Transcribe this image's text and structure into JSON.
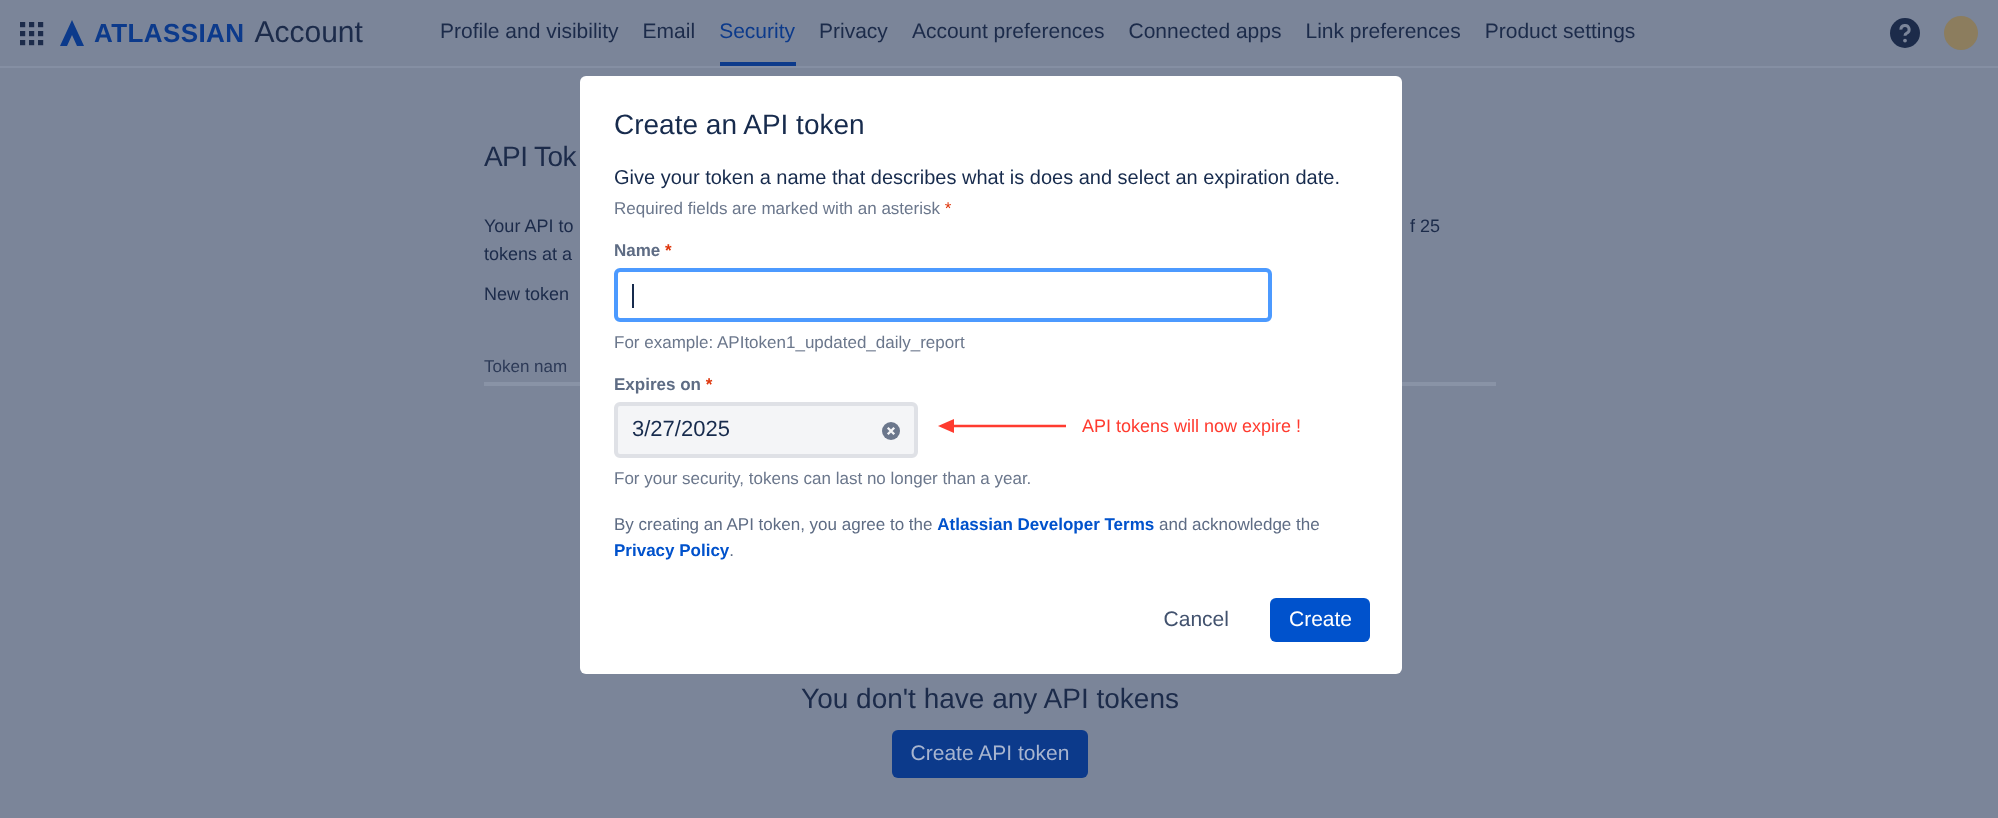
{
  "nav": {
    "logo_brand": "ATLASSIAN",
    "logo_product": "Account",
    "tabs": [
      {
        "label": "Profile and visibility",
        "selected": false
      },
      {
        "label": "Email",
        "selected": false
      },
      {
        "label": "Security",
        "selected": true
      },
      {
        "label": "Privacy",
        "selected": false
      },
      {
        "label": "Account preferences",
        "selected": false
      },
      {
        "label": "Connected apps",
        "selected": false
      },
      {
        "label": "Link preferences",
        "selected": false
      },
      {
        "label": "Product settings",
        "selected": false
      }
    ]
  },
  "page": {
    "title": "API Tok",
    "intro_lines": [
      "Your API to",
      "tokens at a"
    ],
    "intro_right": "f 25",
    "new_tokens": "New token",
    "column_1": "Token nam",
    "empty_state": "You don't have any API tokens",
    "create_button": "Create API token"
  },
  "modal": {
    "title": "Create an API token",
    "description": "Give your token a name that describes what is does and select an expiration date.",
    "required_note": "Required fields are marked with an asterisk",
    "required_mark": "*",
    "fields": [
      {
        "kind": "text",
        "label": "Name",
        "required": true,
        "focused": true,
        "hint": "For example: APItoken1_updated_daily_report"
      },
      {
        "kind": "date",
        "label": "Expires on",
        "required": true,
        "focused": false,
        "value": "3/27/2025",
        "hint": "For your security, tokens can last no longer than a year."
      }
    ],
    "consent_before": "By creating an API token, you agree to the",
    "consent_link_1": "Atlassian Developer Terms",
    "consent_middle": "and acknowledge the",
    "consent_link_2": "Privacy Policy",
    "consent_after": ".",
    "buttons": [
      {
        "label": "Cancel",
        "kind": "subtle"
      },
      {
        "label": "Create",
        "kind": "primary"
      }
    ]
  },
  "annotation": {
    "text": "API tokens will now expire !"
  }
}
